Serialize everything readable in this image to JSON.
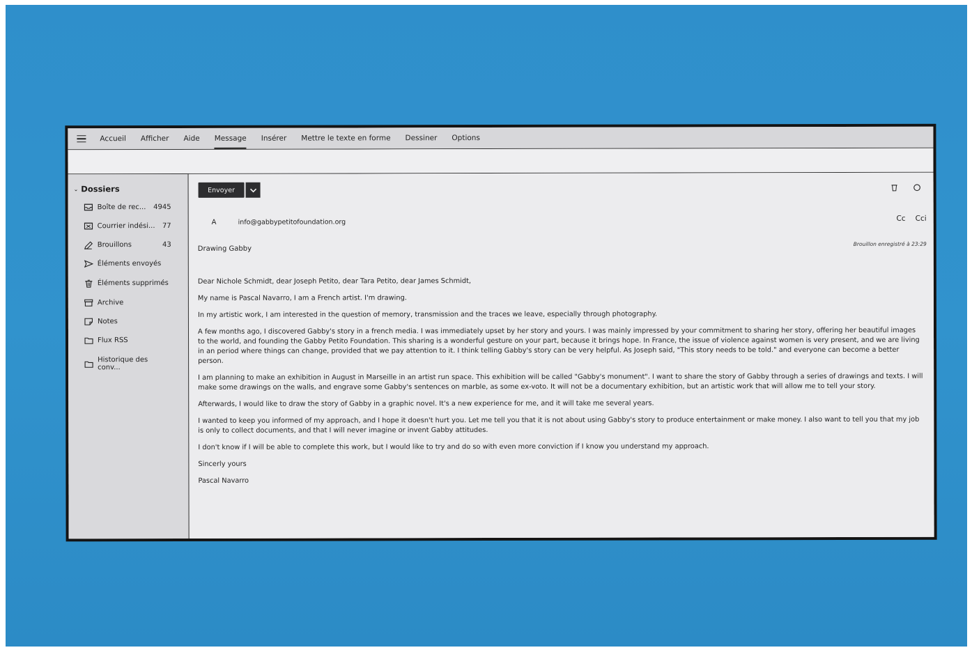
{
  "menubar": {
    "items": [
      "Accueil",
      "Afficher",
      "Aide",
      "Message",
      "Insérer",
      "Mettre le texte en forme",
      "Dessiner",
      "Options"
    ],
    "active": "Message"
  },
  "sidebar": {
    "header": "Dossiers",
    "folders": [
      {
        "label": "Boîte de rec...",
        "count": "4945",
        "icon": "inbox-icon"
      },
      {
        "label": "Courrier indési...",
        "count": "77",
        "icon": "junk-icon"
      },
      {
        "label": "Brouillons",
        "count": "43",
        "icon": "drafts-icon"
      },
      {
        "label": "Éléments envoyés",
        "count": "",
        "icon": "sent-icon"
      },
      {
        "label": "Éléments supprimés",
        "count": "",
        "icon": "trash-icon"
      },
      {
        "label": "Archive",
        "count": "",
        "icon": "archive-icon"
      },
      {
        "label": "Notes",
        "count": "",
        "icon": "notes-icon"
      },
      {
        "label": "Flux RSS",
        "count": "",
        "icon": "rss-folder-icon"
      },
      {
        "label": "Historique des conv...",
        "count": "",
        "icon": "history-folder-icon"
      }
    ]
  },
  "compose": {
    "send_label": "Envoyer",
    "to_label": "A",
    "to_value": "info@gabbypetitofoundation.org",
    "cc_label": "Cc",
    "bcc_label": "Cci",
    "subject": "Drawing Gabby",
    "draft_status": "Brouillon enregistré à 23:29",
    "body": [
      "Dear Nichole Schmidt, dear Joseph Petito, dear Tara Petito, dear James Schmidt,",
      "My name is Pascal Navarro, I am a French artist. I'm drawing.",
      "In my artistic work, I am interested in the question of memory, transmission and the traces we leave, especially through photography.",
      "A few months ago, I discovered Gabby's story in a french media. I was immediately upset by her story and yours. I was mainly impressed by your commitment to sharing her story, offering her beautiful images to the world, and founding the Gabby Petito Foundation. This sharing is a wonderful gesture on your part, because it brings hope. In France, the issue of violence against women is very present, and we are living in an period where things can change, provided that we pay attention to it. I think telling Gabby's story can be very helpful. As Joseph said, \"This story needs to be told.\" and everyone can become a better person.",
      "I am planning to make an exhibition in August in Marseille in an artist run space. This exhibition will be called \"Gabby's monument\". I want to share the story of Gabby through a series of drawings and texts. I will make some drawings on the walls, and engrave some Gabby's sentences on marble, as some ex-voto. It will not be a documentary exhibition, but an artistic work that will allow me to tell your story.",
      "Afterwards, I would like to draw the story of Gabby in a graphic novel. It's a new experience for me, and it will take me several years.",
      "I wanted to keep you informed of my approach, and I hope it doesn't hurt you. Let me tell you that it is not about using Gabby's story to produce entertainment or make money. I also want to tell you that my job is only to collect documents, and that I will never imagine or invent Gabby attitudes.",
      "I don't know if I will be able to complete this work, but I would like to try and do so with even more conviction if I know you understand my approach.",
      "Sincerly yours",
      "Pascal Navarro"
    ]
  }
}
